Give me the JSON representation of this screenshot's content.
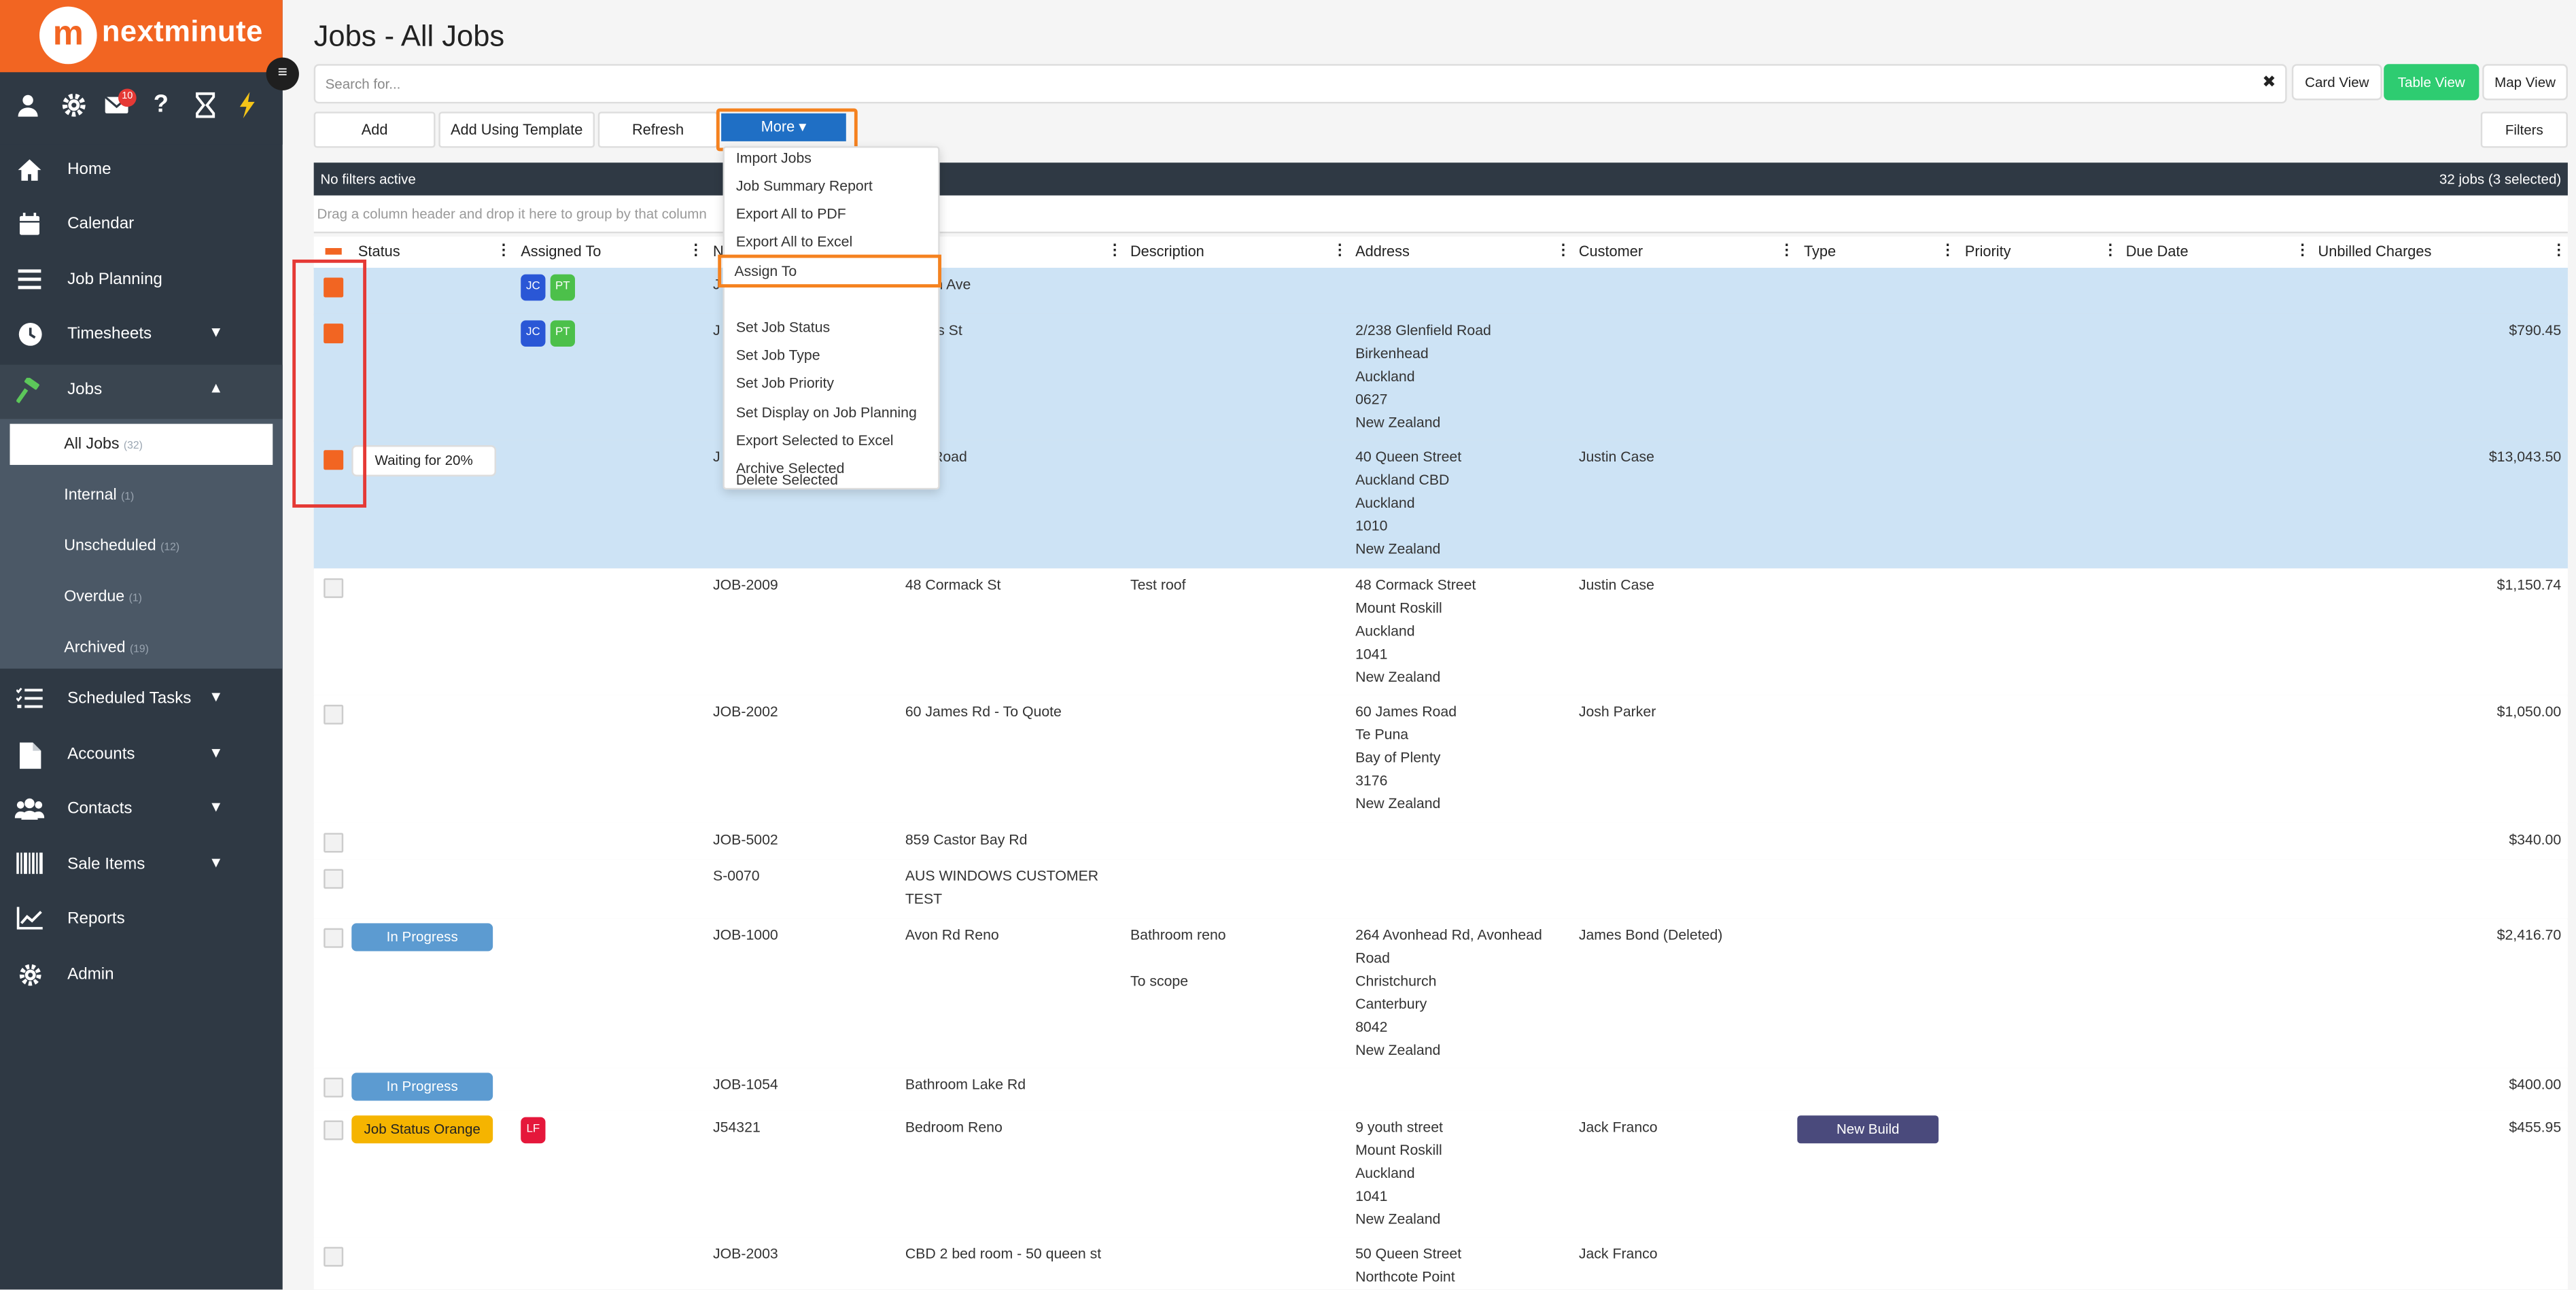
{
  "app": {
    "logo_text": "nextminute",
    "logo_letter": "m",
    "unread_count": "10"
  },
  "sidebar": {
    "items": [
      {
        "label": "Home",
        "icon": "home-icon"
      },
      {
        "label": "Calendar",
        "icon": "calendar-icon"
      },
      {
        "label": "Job Planning",
        "icon": "list-icon"
      },
      {
        "label": "Timesheets",
        "icon": "clock-icon"
      },
      {
        "label": "Jobs",
        "icon": "hammer-icon"
      },
      {
        "label": "Scheduled Tasks",
        "icon": "tasks-icon"
      },
      {
        "label": "Accounts",
        "icon": "document-icon"
      },
      {
        "label": "Contacts",
        "icon": "users-icon"
      },
      {
        "label": "Sale Items",
        "icon": "barcode-icon"
      },
      {
        "label": "Reports",
        "icon": "chart-icon"
      },
      {
        "label": "Admin",
        "icon": "gear-icon"
      }
    ],
    "jobs_sub": [
      {
        "label": "All Jobs",
        "count": "(32)"
      },
      {
        "label": "Internal",
        "count": "(1)"
      },
      {
        "label": "Unscheduled",
        "count": "(12)"
      },
      {
        "label": "Overdue",
        "count": "(1)"
      },
      {
        "label": "Archived",
        "count": "(19)"
      }
    ]
  },
  "page": {
    "title": "Jobs - All Jobs"
  },
  "search": {
    "placeholder": "Search for..."
  },
  "views": {
    "card": "Card View",
    "table": "Table View",
    "map": "Map View"
  },
  "toolbar": {
    "add": "Add",
    "add_template": "Add Using Template",
    "refresh": "Refresh",
    "more": "More ▾",
    "filters": "Filters"
  },
  "summary": {
    "filters": "No filters active",
    "count": "32 jobs (3 selected)"
  },
  "group_hint": "Drag a column header and drop it here to group by that column",
  "columns": [
    "Status",
    "Assigned To",
    "N",
    "Description",
    "Address",
    "Customer",
    "Type",
    "Priority",
    "Due Date",
    "Unbilled Charges"
  ],
  "more_menu": [
    "Import Jobs",
    "Job Summary Report",
    "Export All to PDF",
    "Export All to Excel",
    "Assign To",
    "Set Job Status",
    "Set Job Type",
    "Set Job Priority",
    "Set Display on Job Planning",
    "Export Selected to Excel",
    "Archive Selected",
    "Delete Selected"
  ],
  "rows": [
    {
      "num": "J",
      "name": "ckson Ave",
      "status": "",
      "desc": "",
      "address": "",
      "customer": "",
      "type": "",
      "charges": "",
      "assignees": [
        "JC",
        "PT"
      ]
    },
    {
      "num": "J",
      "name": "ueens St",
      "status": "",
      "desc": "",
      "address": "2/238 Glenfield Road\nBirkenhead\nAuckland\n0627\nNew Zealand",
      "customer": "",
      "type": "",
      "charges": "$790.45",
      "assignees": [
        "JC",
        "PT"
      ]
    },
    {
      "num": "J",
      "name": "ake Road",
      "status": "Waiting for 20%",
      "desc": "",
      "address": "40 Queen Street\nAuckland CBD\nAuckland\n1010\nNew Zealand",
      "customer": "Justin Case",
      "type": "",
      "charges": "$13,043.50",
      "assignees": []
    },
    {
      "num": "JOB-2009",
      "name": "48 Cormack St",
      "status": "",
      "desc": "Test roof",
      "address": "48 Cormack Street\nMount Roskill\nAuckland\n1041\nNew Zealand",
      "customer": "Justin Case",
      "type": "",
      "charges": "$1,150.74",
      "assignees": []
    },
    {
      "num": "JOB-2002",
      "name": "60 James Rd - To Quote",
      "status": "",
      "desc": "",
      "address": "60 James Road\nTe Puna\nBay of Plenty\n3176\nNew Zealand",
      "customer": "Josh Parker",
      "type": "",
      "charges": "$1,050.00",
      "assignees": []
    },
    {
      "num": "JOB-5002",
      "name": "859 Castor Bay Rd",
      "status": "",
      "desc": "",
      "address": "",
      "customer": "",
      "type": "",
      "charges": "$340.00",
      "assignees": []
    },
    {
      "num": "S-0070",
      "name": "AUS WINDOWS CUSTOMER\nTEST",
      "status": "",
      "desc": "",
      "address": "",
      "customer": "",
      "type": "",
      "charges": "",
      "assignees": []
    },
    {
      "num": "JOB-1000",
      "name": "Avon Rd Reno",
      "status": "In Progress",
      "desc": "Bathroom reno\n\nTo scope",
      "address": "264 Avonhead Rd, Avonhead\nRoad\nChristchurch\nCanterbury\n8042\nNew Zealand",
      "customer": "James Bond (Deleted)",
      "type": "",
      "charges": "$2,416.70",
      "assignees": []
    },
    {
      "num": "JOB-1054",
      "name": "Bathroom Lake Rd",
      "status": "In Progress",
      "desc": "",
      "address": "",
      "customer": "",
      "type": "",
      "charges": "$400.00",
      "assignees": []
    },
    {
      "num": "J54321",
      "name": "Bedroom Reno",
      "status": "Job Status Orange",
      "desc": "",
      "address": "9 youth street\nMount Roskill\nAuckland\n1041\nNew Zealand",
      "customer": "Jack Franco",
      "type": "New Build",
      "charges": "$455.95",
      "assignees": [
        "LF"
      ]
    },
    {
      "num": "JOB-2003",
      "name": "CBD 2 bed room - 50 queen st",
      "status": "",
      "desc": "",
      "address": "50 Queen Street\nNorthcote Point",
      "customer": "Jack Franco",
      "type": "",
      "charges": "",
      "assignees": []
    }
  ]
}
